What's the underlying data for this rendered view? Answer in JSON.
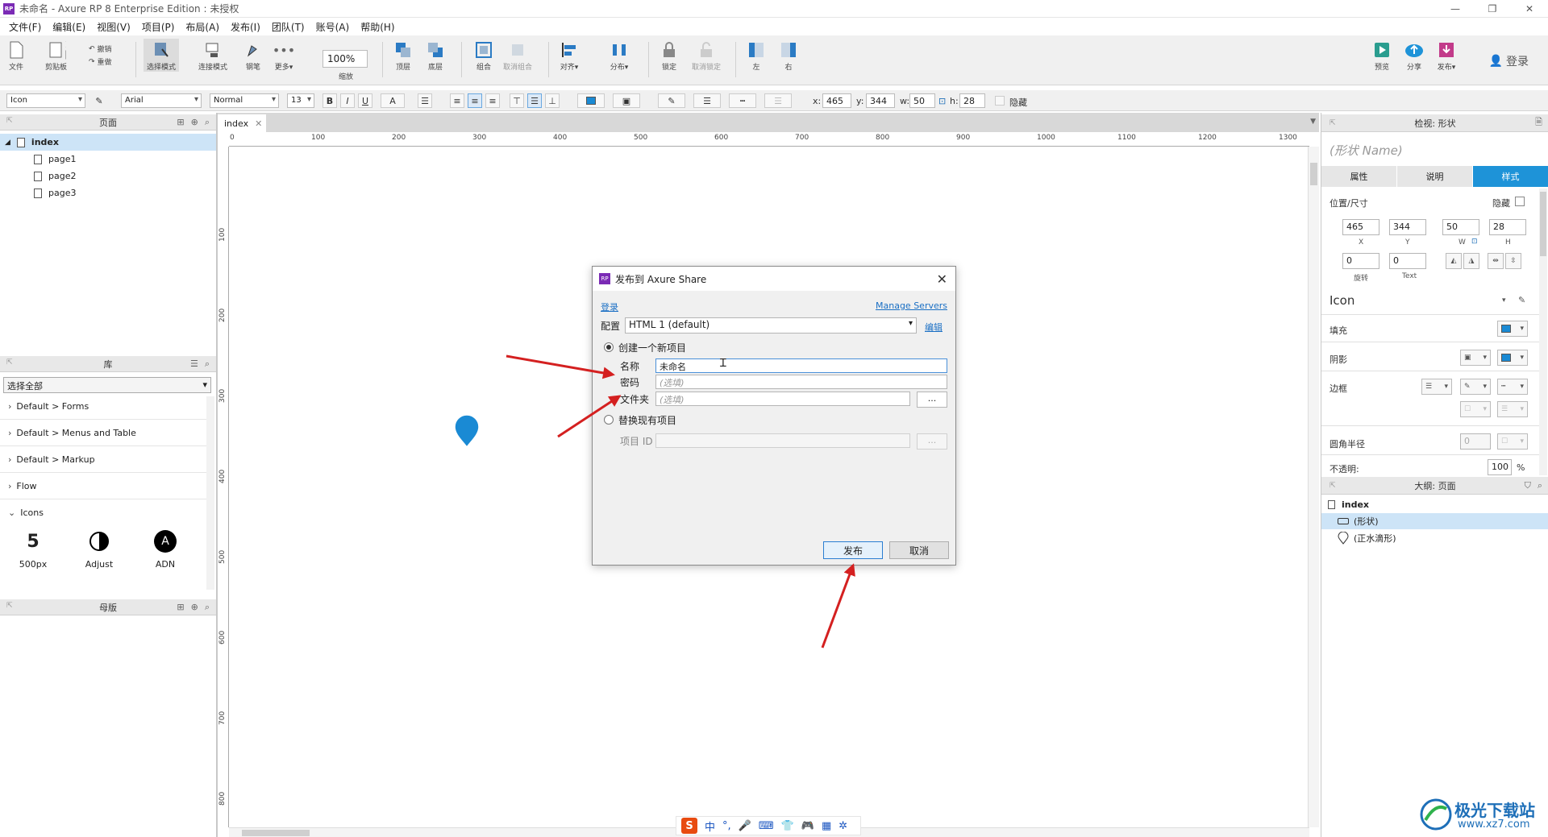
{
  "window": {
    "title": "未命名 - Axure RP 8 Enterprise Edition : 未授权",
    "app_icon": "RP"
  },
  "menu": [
    "文件(F)",
    "编辑(E)",
    "视图(V)",
    "项目(P)",
    "布局(A)",
    "发布(I)",
    "团队(T)",
    "账号(A)",
    "帮助(H)"
  ],
  "toolbar": {
    "file": "文件",
    "clipboard": "剪贴板",
    "undo": "撤销",
    "redo": "重做",
    "select_mode": "选择模式",
    "connect_mode": "连接模式",
    "pen": "钢笔",
    "more": "更多▾",
    "zoom_value": "100%",
    "zoom_label": "缩放",
    "top": "顶层",
    "bottom": "底层",
    "group": "组合",
    "ungroup": "取消组合",
    "align": "对齐▾",
    "distribute": "分布▾",
    "lock": "锁定",
    "unlock": "取消锁定",
    "left": "左",
    "right": "右",
    "preview": "预览",
    "share": "分享",
    "publish": "发布▾",
    "login": "登录"
  },
  "formatbar": {
    "style": "Icon",
    "font": "Arial",
    "weight": "Normal",
    "size": "13",
    "x_label": "x:",
    "x": "465",
    "y_label": "y:",
    "y": "344",
    "w_label": "w:",
    "w": "50",
    "h_label": "h:",
    "h": "28",
    "hidden": "隐藏",
    "bold": "B",
    "italic": "I",
    "underline": "U",
    "font_color": "A"
  },
  "pages_panel": {
    "title": "页面",
    "pages": [
      {
        "label": "index",
        "selected": true
      },
      {
        "label": "page1"
      },
      {
        "label": "page2"
      },
      {
        "label": "page3"
      }
    ]
  },
  "library_panel": {
    "title": "库",
    "selector": "选择全部",
    "groups": [
      "Default > Forms",
      "Default > Menus and Table",
      "Default > Markup",
      "Flow",
      "Icons"
    ],
    "icons": [
      "500px",
      "Adjust",
      "ADN"
    ]
  },
  "masters_panel": {
    "title": "母版"
  },
  "canvas": {
    "tab": "index",
    "ruler_top": [
      "0",
      "100",
      "200",
      "300",
      "400",
      "500",
      "600",
      "700",
      "800",
      "900",
      "1000",
      "1100",
      "1200",
      "1300"
    ],
    "ruler_left": [
      "100",
      "200",
      "300",
      "400",
      "500",
      "600",
      "700",
      "800"
    ]
  },
  "dialog": {
    "title": "发布到 Axure Share",
    "login_link": "登录",
    "manage_servers": "Manage Servers",
    "config_label": "配置",
    "config_value": "HTML 1 (default)",
    "edit_link": "编辑",
    "create_new": "创建一个新项目",
    "name_label": "名称",
    "name_value": "未命名",
    "password_label": "密码",
    "password_placeholder": "(选填)",
    "folder_label": "文件夹",
    "folder_placeholder": "(选填)",
    "browse": "...",
    "replace_existing": "替换现有项目",
    "project_id_label": "项目 ID",
    "publish_button": "发布",
    "cancel_button": "取消",
    "close": "✕"
  },
  "inspector": {
    "title": "检视: 形状",
    "shape_name_placeholder": "(形状 Name)",
    "tabs": [
      "属性",
      "说明",
      "样式"
    ],
    "active_tab": "样式",
    "position_size": "位置/尺寸",
    "hidden": "隐藏",
    "x": "465",
    "y": "344",
    "w": "50",
    "h": "28",
    "x_lbl": "X",
    "y_lbl": "Y",
    "w_lbl": "W",
    "h_lbl": "H",
    "rotation": "0",
    "rotation_lbl": "旋转",
    "text_rotation": "0",
    "text_lbl": "Text",
    "style_name": "Icon",
    "fill": "填充",
    "shadow": "阴影",
    "border": "边框",
    "corner_radius": "圆角半径",
    "corner_value": "0",
    "opacity": "不透明:",
    "opacity_value": "100",
    "opacity_unit": "%"
  },
  "outline": {
    "title": "大纲: 页面",
    "root": "index",
    "items": [
      "(形状)",
      "(正水滴形)"
    ]
  },
  "ime": {
    "items": [
      "中",
      "°,",
      "🎤",
      "⌨",
      "👕",
      "🎮",
      "▦",
      "✲"
    ],
    "logo": "S"
  },
  "watermark": {
    "text": "极光下载站",
    "url": "www.xz7.com"
  },
  "colors": {
    "accent": "#1e93d8",
    "drop": "#1a8ad4",
    "arrow": "#d42020",
    "brand": "#7b2bb5"
  }
}
